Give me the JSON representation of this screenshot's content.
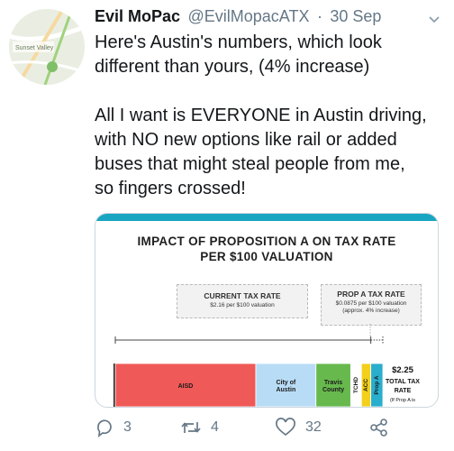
{
  "tweet": {
    "display_name": "Evil MoPac",
    "handle": "@EvilMopacATX",
    "separator": "·",
    "date": "30 Sep",
    "avatar_map_label": "Sunset Valley",
    "paragraph1": "Here's Austin's numbers, which look\ndifferent than yours, (4% increase)",
    "paragraph2": "All I want is EVERYONE in Austin driving,\nwith NO new options like rail or added\nbuses that might steal people from me,\nso fingers crossed!"
  },
  "image_card": {
    "title_line1": "IMPACT OF PROPOSITION A ON TAX RATE",
    "title_line2": "PER $100 VALUATION",
    "current_box": {
      "title": "CURRENT TAX RATE",
      "subtitle": "$2.16 per $100 valuation"
    },
    "prop_box": {
      "title": "PROP A TAX RATE",
      "subtitle_line1": "$0.0875 per $100 valuation",
      "subtitle_line2": "(approx. 4% increase)"
    },
    "total_value": "$2.25",
    "total_label_line1": "TOTAL TAX",
    "total_label_line2": "RATE",
    "total_note": "(If Prop A is"
  },
  "chart_data": {
    "type": "bar",
    "stacked": true,
    "orientation": "horizontal",
    "segments": [
      {
        "label": "AISD",
        "color": "#ef5957",
        "share": 0.525
      },
      {
        "label": "City of Austin",
        "color": "#b9dcf6",
        "share": 0.225
      },
      {
        "label": "Travis County",
        "color": "#67b94d",
        "share": 0.13
      },
      {
        "label": "TCHD",
        "color": "#ffffff",
        "share": 0.04
      },
      {
        "label": "ACC",
        "color": "#f4cf1b",
        "share": 0.035
      },
      {
        "label": "Prop A",
        "color": "#29aecd",
        "share": 0.045
      }
    ],
    "current_rate": 2.16,
    "prop_a_rate": 0.0875,
    "total_rate": 2.25
  },
  "actions": {
    "reply_count": "3",
    "retweet_count": "4",
    "like_count": "32"
  },
  "colors": {
    "accent": "#18a5c2",
    "muted_text": "#657786"
  },
  "icons": [
    "chevron-down-icon",
    "reply-icon",
    "retweet-icon",
    "like-icon",
    "share-icon"
  ]
}
